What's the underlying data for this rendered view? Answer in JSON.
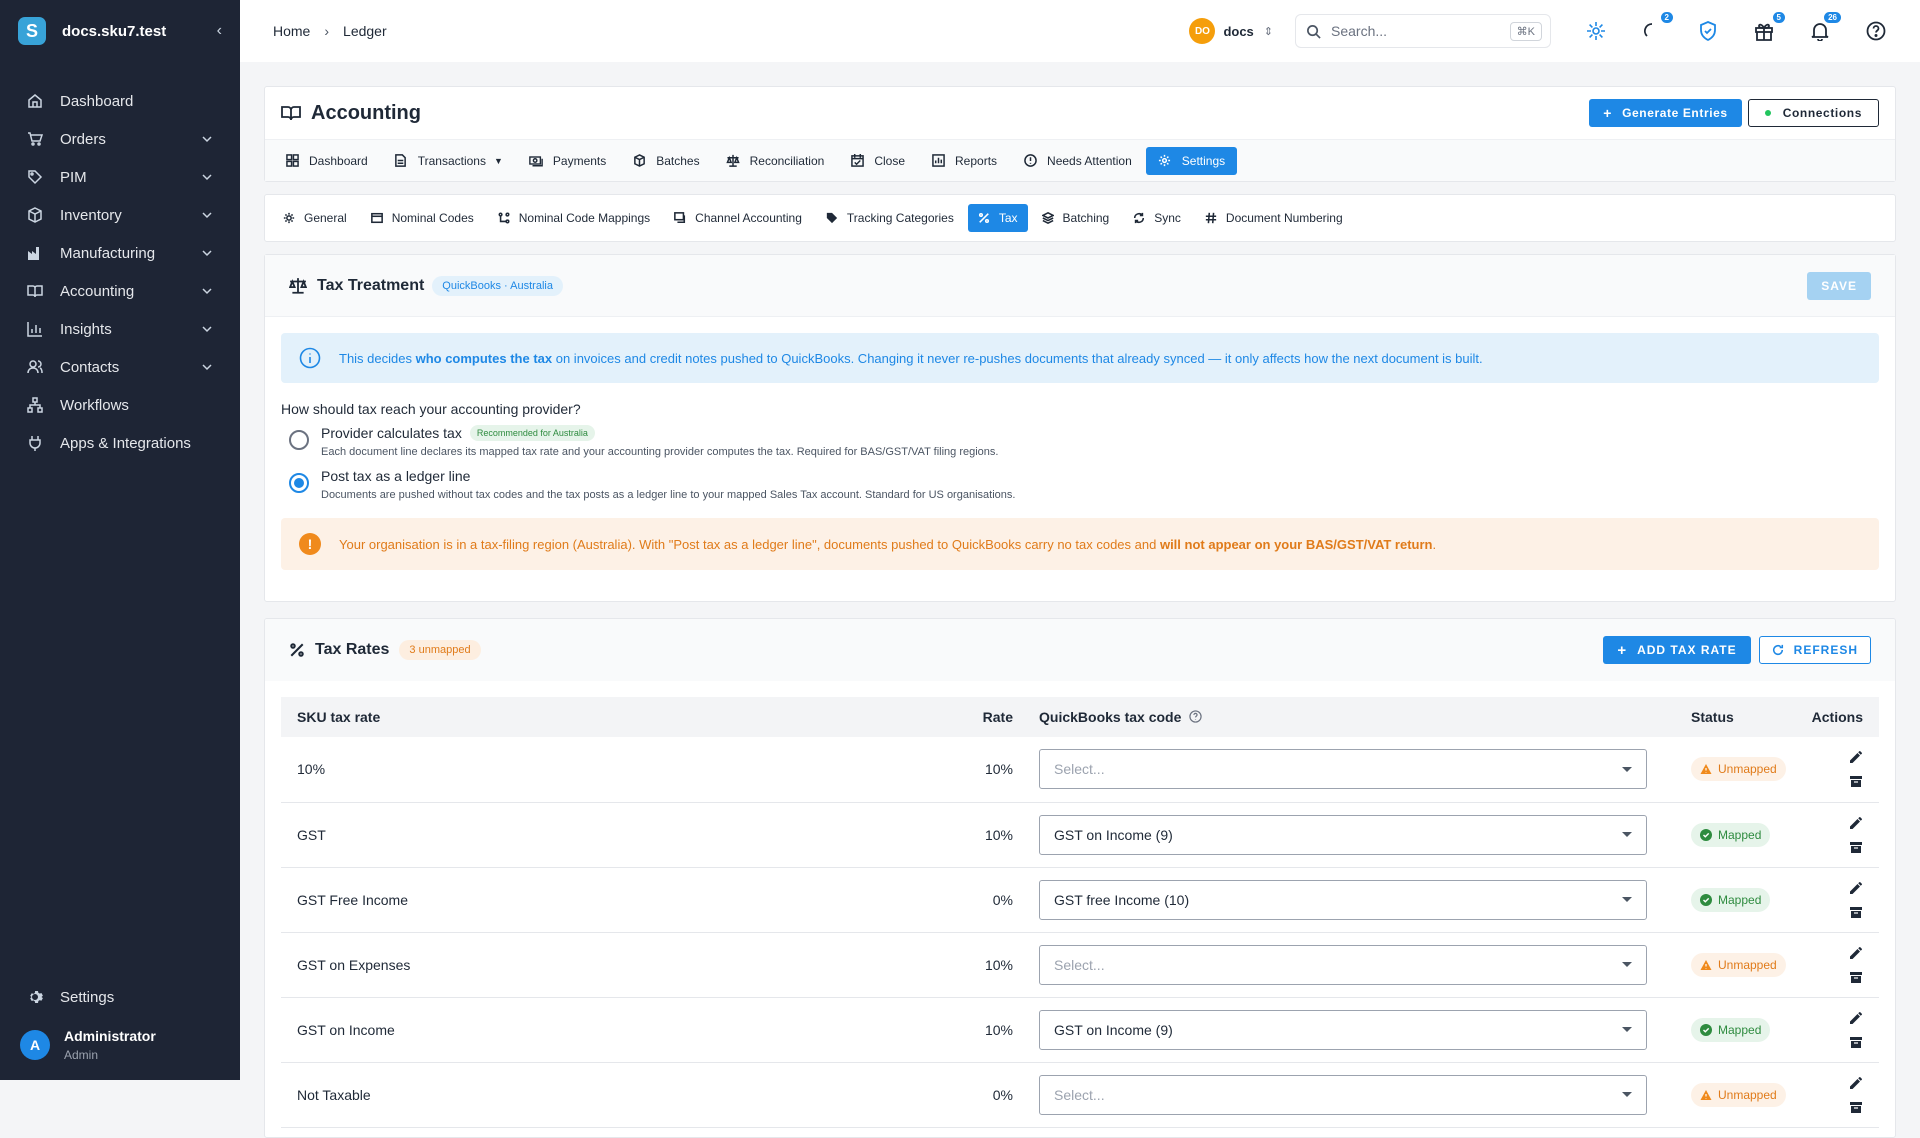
{
  "sidebar": {
    "brand": "docs.sku7.test",
    "brand_letter": "S",
    "items": [
      {
        "label": "Dashboard",
        "icon": "home-icon"
      },
      {
        "label": "Orders",
        "icon": "cart-icon"
      },
      {
        "label": "PIM",
        "icon": "tag-icon"
      },
      {
        "label": "Inventory",
        "icon": "box-icon"
      },
      {
        "label": "Manufacturing",
        "icon": "factory-icon"
      },
      {
        "label": "Accounting",
        "icon": "book-icon"
      },
      {
        "label": "Insights",
        "icon": "chart-icon"
      },
      {
        "label": "Contacts",
        "icon": "users-icon"
      },
      {
        "label": "Workflows",
        "icon": "workflow-icon"
      },
      {
        "label": "Apps & Integrations",
        "icon": "plug-icon"
      }
    ],
    "settings_label": "Settings",
    "user": {
      "initial": "A",
      "name": "Administrator",
      "role": "Admin"
    }
  },
  "topbar": {
    "breadcrumb": [
      "Home",
      "Ledger"
    ],
    "org_initials": "DO",
    "org_name": "docs",
    "search_placeholder": "Search...",
    "search_shortcut": "⌘K",
    "badges": {
      "status": "2",
      "gifts": "5",
      "notifications": "26"
    }
  },
  "accounting": {
    "title": "Accounting",
    "generate_label": "Generate Entries",
    "connections_label": "Connections",
    "tabs": [
      "Dashboard",
      "Transactions",
      "Payments",
      "Batches",
      "Reconciliation",
      "Close",
      "Reports",
      "Needs Attention",
      "Settings"
    ],
    "active_tab": "Settings"
  },
  "settings_tabs": [
    "General",
    "Nominal Codes",
    "Nominal Code Mappings",
    "Channel Accounting",
    "Tracking Categories",
    "Tax",
    "Batching",
    "Sync",
    "Document Numbering"
  ],
  "tax_treatment": {
    "title": "Tax Treatment",
    "provider_chip": "QuickBooks · Australia",
    "save_label": "SAVE",
    "info_pre": "This decides ",
    "info_bold": "who computes the tax",
    "info_post": " on invoices and credit notes pushed to QuickBooks. Changing it never re-pushes documents that already synced — it only affects how the next document is built.",
    "question": "How should tax reach your accounting provider?",
    "options": [
      {
        "title": "Provider calculates tax",
        "chip": "Recommended for Australia",
        "desc": "Each document line declares its mapped tax rate and your accounting provider computes the tax. Required for BAS/GST/VAT filing regions.",
        "selected": false
      },
      {
        "title": "Post tax as a ledger line",
        "desc": "Documents are pushed without tax codes and the tax posts as a ledger line to your mapped Sales Tax account. Standard for US organisations.",
        "selected": true
      }
    ],
    "warning_pre": "Your organisation is in a tax-filing region (Australia). With \"Post tax as a ledger line\", documents pushed to QuickBooks carry no tax codes and ",
    "warning_bold": "will not appear on your BAS/GST/VAT return",
    "warning_post": "."
  },
  "tax_rates": {
    "title": "Tax Rates",
    "unmapped_chip": "3 unmapped",
    "add_label": "ADD TAX RATE",
    "refresh_label": "REFRESH",
    "columns": {
      "name": "SKU tax rate",
      "rate": "Rate",
      "code": "QuickBooks tax code",
      "status": "Status",
      "actions": "Actions"
    },
    "rows": [
      {
        "name": "10%",
        "rate": "10%",
        "code": "Select...",
        "placeholder": true,
        "status": "Unmapped"
      },
      {
        "name": "GST",
        "rate": "10%",
        "code": "GST on Income (9)",
        "placeholder": false,
        "status": "Mapped"
      },
      {
        "name": "GST Free Income",
        "rate": "0%",
        "code": "GST free Income (10)",
        "placeholder": false,
        "status": "Mapped"
      },
      {
        "name": "GST on Expenses",
        "rate": "10%",
        "code": "Select...",
        "placeholder": true,
        "status": "Unmapped"
      },
      {
        "name": "GST on Income",
        "rate": "10%",
        "code": "GST on Income (9)",
        "placeholder": false,
        "status": "Mapped"
      },
      {
        "name": "Not Taxable",
        "rate": "0%",
        "code": "Select...",
        "placeholder": true,
        "status": "Unmapped"
      }
    ]
  },
  "colors": {
    "accent": "#1e88e5",
    "sidebar": "#1e2535",
    "warning": "#e07b1a",
    "success": "#2e8b3f"
  }
}
